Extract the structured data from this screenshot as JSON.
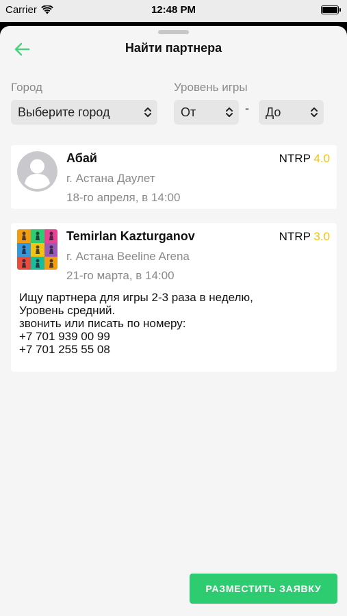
{
  "status": {
    "carrier": "Carrier",
    "time": "12:48 PM"
  },
  "header": {
    "title": "Найти партнера",
    "back_icon": "arrow-left-icon",
    "accent": "#4cd07f"
  },
  "filters": {
    "city_label": "Город",
    "city_value": "Выберите город",
    "level_label": "Уровень игры",
    "level_from": "От",
    "level_separator": "-",
    "level_to": "До"
  },
  "cards": [
    {
      "name": "Абай",
      "ntrp_label": "NTRP",
      "ntrp_value": "4.0",
      "place": "г. Астана Даулет",
      "date": "18-го апреля, в 14:00",
      "avatar": "default-user-avatar"
    },
    {
      "name": "Temirlan Kazturganov",
      "ntrp_label": "NTRP",
      "ntrp_value": "3.0",
      "place": "г. Астана Beeline Arena",
      "date": "21-го марта, в 14:00",
      "avatar": "pop-art-tennis-avatar",
      "description": [
        "Ищу партнера для игры 2-3 раза в неделю,",
        "Уровень средний.",
        "звонить или писать по номеру:",
        "+7 701 939 00 99",
        "+7 701 255 55 08"
      ]
    }
  ],
  "cta": {
    "label": "РАЗМЕСТИТЬ ЗАЯВКУ",
    "color": "#2ecc71"
  },
  "colors": {
    "rating": "#f4c20d",
    "muted": "#8a8a8a",
    "background": "#f5f5f5"
  }
}
